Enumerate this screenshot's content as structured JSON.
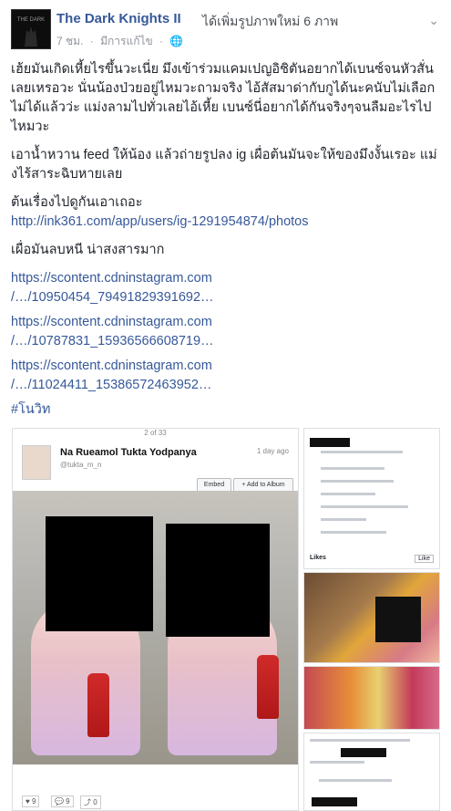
{
  "post": {
    "page_name": "The Dark Knights II",
    "action": "ได้เพิ่มรูปภาพใหม่ 6 ภาพ",
    "time": "7 ชม.",
    "edited": "มีการแก้ไข",
    "privacy_icon": "globe-icon",
    "menu_icon": "chevron-down-icon",
    "paragraphs": [
      "เฮ้ยมันเกิดเหี้ยไรขึ้นวะเนี่ย มึงเข้าร่วมแคมเปญอิชิตันอยากได้เบนซ์จนหัวสั่นเลยเหรอวะ นั่นน้องป่วยอยู่ไหมวะถามจริง ไอ้สัสมาด่ากับกูได้นะคนับไม่เลือกไม่ได้แล้วว่ะ แม่งลามไปทั่วเลยไอ้เหี้ย เบนซ์นี่อยากได้กันจริงๆจนลืมอะไรไปไหมวะ",
      "เอาน้ำหวาน feed ให้น้อง แล้วถ่ายรูปลง ig เผื่อต้นมันจะให้ของมึงงั้นเรอะ แม่งไร้สาระฉิบหายเลย",
      "ต้นเรื่องไปดูกันเอาเถอะ"
    ],
    "link1": "http://ink361.com/app/users/ig-1291954874/photos",
    "paragraph4": "เผื่อมันลบหนี น่าสงสารมาก",
    "links": [
      {
        "line1": "https://scontent.cdninstagram.com",
        "line2": "/…/10950454_79491829391692…"
      },
      {
        "line1": "https://scontent.cdninstagram.com",
        "line2": "/…/10787831_15936566608719…"
      },
      {
        "line1": "https://scontent.cdninstagram.com",
        "line2": "/…/11024411_15386572463952…"
      }
    ],
    "hashtag": "#โนวิท"
  },
  "photo": {
    "counter": "2 of 33",
    "ig_name": "Na Rueamol Tukta Yodpanya",
    "ig_user": "@tukta_m_n",
    "ig_ago": "1 day ago",
    "embed_label": "Embed",
    "add_label": "+ Add to Album",
    "likes": "♥ 9",
    "comments": "💬 9",
    "reposts": "⤴ 0"
  },
  "side_photo": {
    "likes_label": "Likes",
    "like_btn": "Like"
  }
}
